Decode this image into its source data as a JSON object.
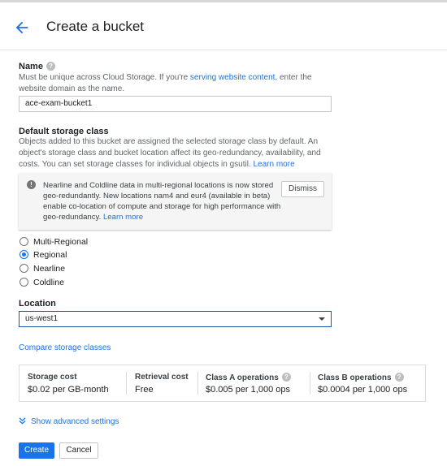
{
  "header": {
    "title": "Create a bucket",
    "back_icon": "arrow-back-icon"
  },
  "name_section": {
    "label": "Name",
    "help_prefix": "Must be unique across Cloud Storage. If you're ",
    "help_link": "serving website content",
    "help_suffix": ", enter the website domain as the name.",
    "value": "ace-exam-bucket1"
  },
  "storage_class": {
    "label": "Default storage class",
    "help_text": "Objects added to this bucket are assigned the selected storage class by default. An object's storage class and bucket location affect its geo-redundancy, availability, and costs. You can set storage classes for individual objects in gsutil. ",
    "help_link": "Learn more",
    "notice": {
      "text": "Nearline and Coldline data in multi-regional locations is now stored geo-redundantly. New locations nam4 and eur4 (available in beta) enable co-location of compute and storage for high performance with geo-redundancy. ",
      "link": "Learn more",
      "dismiss_label": "Dismiss"
    },
    "options": [
      {
        "label": "Multi-Regional",
        "selected": false
      },
      {
        "label": "Regional",
        "selected": true
      },
      {
        "label": "Nearline",
        "selected": false
      },
      {
        "label": "Coldline",
        "selected": false
      }
    ]
  },
  "location": {
    "label": "Location",
    "value": "us-west1"
  },
  "compare_link": "Compare storage classes",
  "costs": [
    {
      "header": "Storage cost",
      "value": "$0.02 per GB-month",
      "has_help": false
    },
    {
      "header": "Retrieval cost",
      "value": "Free",
      "has_help": false
    },
    {
      "header": "Class A operations",
      "value": "$0.005 per 1,000 ops",
      "has_help": true
    },
    {
      "header": "Class B operations",
      "value": "$0.0004 per 1,000 ops",
      "has_help": true
    }
  ],
  "advanced_link": "Show advanced settings",
  "actions": {
    "create_label": "Create",
    "cancel_label": "Cancel"
  },
  "colors": {
    "accent": "#1a73e8",
    "text": "#202124",
    "muted": "#5f6368"
  },
  "help_icon_glyph": "?",
  "info_icon_glyph": "!"
}
